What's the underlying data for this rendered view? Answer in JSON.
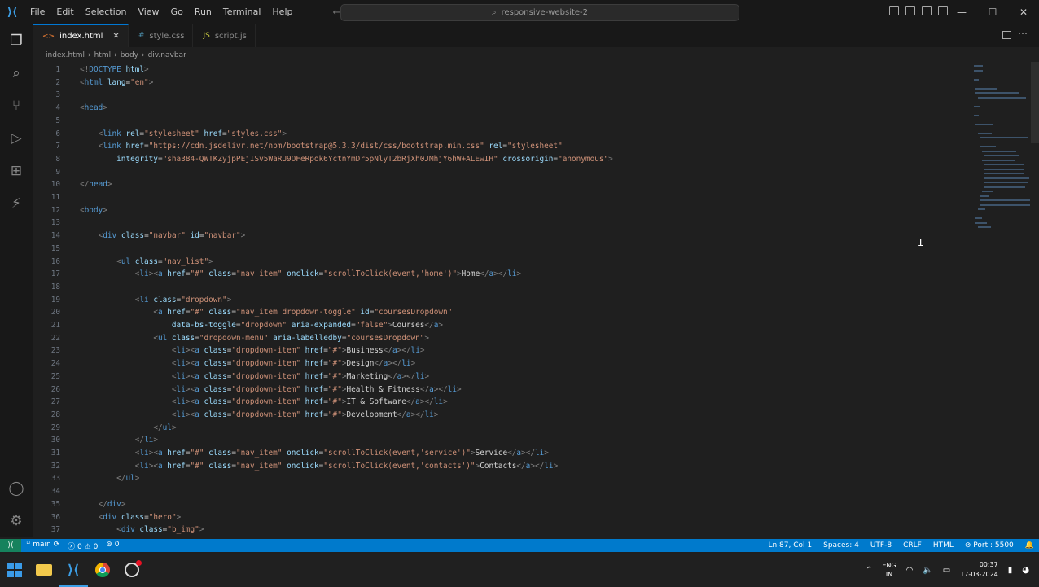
{
  "titlebar": {
    "menu": [
      "File",
      "Edit",
      "Selection",
      "View",
      "Go",
      "Run",
      "Terminal",
      "Help"
    ],
    "search_text": "responsive-website-2"
  },
  "tabs": [
    {
      "label": "index.html",
      "icon": "<>",
      "active": true
    },
    {
      "label": "style.css",
      "icon": "#",
      "active": false
    },
    {
      "label": "script.js",
      "icon": "JS",
      "active": false
    }
  ],
  "breadcrumb": [
    "index.html",
    "html",
    "body",
    "div.navbar"
  ],
  "code_lines": [
    {
      "n": "1",
      "html": "<span class='t'>&lt;!</span><span class='tg'>DOCTYPE</span> <span class='at'>html</span><span class='t'>&gt;</span>"
    },
    {
      "n": "2",
      "html": "<span class='t'>&lt;</span><span class='tg'>html</span> <span class='at'>lang</span><span class='tx'>=</span><span class='st'>\"en\"</span><span class='t'>&gt;</span>"
    },
    {
      "n": "3",
      "html": ""
    },
    {
      "n": "4",
      "html": "<span class='t'>&lt;</span><span class='tg'>head</span><span class='t'>&gt;</span>"
    },
    {
      "n": "5",
      "html": ""
    },
    {
      "n": "6",
      "html": "    <span class='t'>&lt;</span><span class='tg'>link</span> <span class='at'>rel</span><span class='tx'>=</span><span class='st'>\"stylesheet\"</span> <span class='at'>href</span><span class='tx'>=</span><span class='st'>\"styles.css\"</span><span class='t'>&gt;</span>"
    },
    {
      "n": "7",
      "html": "    <span class='t'>&lt;</span><span class='tg'>link</span> <span class='at'>href</span><span class='tx'>=</span><span class='st'>\"https://cdn.jsdelivr.net/npm/bootstrap@5.3.3/dist/css/bootstrap.min.css\"</span> <span class='at'>rel</span><span class='tx'>=</span><span class='st'>\"stylesheet\"</span>"
    },
    {
      "n": "8",
      "html": "        <span class='at'>integrity</span><span class='tx'>=</span><span class='st'>\"sha384-QWTKZyjpPEjISv5WaRU9OFeRpok6YctnYmDr5pNlyT2bRjXh0JMhjY6hW+ALEwIH\"</span> <span class='at'>crossorigin</span><span class='tx'>=</span><span class='st'>\"anonymous\"</span><span class='t'>&gt;</span>"
    },
    {
      "n": "9",
      "html": ""
    },
    {
      "n": "10",
      "html": "<span class='t'>&lt;/</span><span class='tg'>head</span><span class='t'>&gt;</span>"
    },
    {
      "n": "11",
      "html": ""
    },
    {
      "n": "12",
      "html": "<span class='t'>&lt;</span><span class='tg'>body</span><span class='t'>&gt;</span>"
    },
    {
      "n": "13",
      "html": ""
    },
    {
      "n": "14",
      "html": "    <span class='t'>&lt;</span><span class='tg'>div</span> <span class='at'>class</span><span class='tx'>=</span><span class='st'>\"navbar\"</span> <span class='at'>id</span><span class='tx'>=</span><span class='st'>\"navbar\"</span><span class='t'>&gt;</span>"
    },
    {
      "n": "15",
      "html": ""
    },
    {
      "n": "16",
      "html": "        <span class='t'>&lt;</span><span class='tg'>ul</span> <span class='at'>class</span><span class='tx'>=</span><span class='st'>\"nav_list\"</span><span class='t'>&gt;</span>"
    },
    {
      "n": "17",
      "html": "            <span class='t'>&lt;</span><span class='tg'>li</span><span class='t'>&gt;&lt;</span><span class='tg'>a</span> <span class='at'>href</span><span class='tx'>=</span><span class='st'>\"#\"</span> <span class='at'>class</span><span class='tx'>=</span><span class='st'>\"nav_item\"</span> <span class='at'>onclick</span><span class='tx'>=</span><span class='st'>\"scrollToClick(event,'home')\"</span><span class='t'>&gt;</span><span class='tx'>Home</span><span class='t'>&lt;/</span><span class='tg'>a</span><span class='t'>&gt;&lt;/</span><span class='tg'>li</span><span class='t'>&gt;</span>"
    },
    {
      "n": "18",
      "html": ""
    },
    {
      "n": "19",
      "html": "            <span class='t'>&lt;</span><span class='tg'>li</span> <span class='at'>class</span><span class='tx'>=</span><span class='st'>\"dropdown\"</span><span class='t'>&gt;</span>"
    },
    {
      "n": "20",
      "html": "                <span class='t'>&lt;</span><span class='tg'>a</span> <span class='at'>href</span><span class='tx'>=</span><span class='st'>\"#\"</span> <span class='at'>class</span><span class='tx'>=</span><span class='st'>\"nav_item dropdown-toggle\"</span> <span class='at'>id</span><span class='tx'>=</span><span class='st'>\"coursesDropdown\"</span>"
    },
    {
      "n": "21",
      "html": "                    <span class='at'>data-bs-toggle</span><span class='tx'>=</span><span class='st'>\"dropdown\"</span> <span class='at'>aria-expanded</span><span class='tx'>=</span><span class='st'>\"false\"</span><span class='t'>&gt;</span><span class='tx'>Courses</span><span class='t'>&lt;/</span><span class='tg'>a</span><span class='t'>&gt;</span>"
    },
    {
      "n": "22",
      "html": "                <span class='t'>&lt;</span><span class='tg'>ul</span> <span class='at'>class</span><span class='tx'>=</span><span class='st'>\"dropdown-menu\"</span> <span class='at'>aria-labelledby</span><span class='tx'>=</span><span class='st'>\"coursesDropdown\"</span><span class='t'>&gt;</span>"
    },
    {
      "n": "23",
      "html": "                    <span class='t'>&lt;</span><span class='tg'>li</span><span class='t'>&gt;&lt;</span><span class='tg'>a</span> <span class='at'>class</span><span class='tx'>=</span><span class='st'>\"dropdown-item\"</span> <span class='at'>href</span><span class='tx'>=</span><span class='st'>\"#\"</span><span class='t'>&gt;</span><span class='tx'>Business</span><span class='t'>&lt;/</span><span class='tg'>a</span><span class='t'>&gt;&lt;/</span><span class='tg'>li</span><span class='t'>&gt;</span>"
    },
    {
      "n": "24",
      "html": "                    <span class='t'>&lt;</span><span class='tg'>li</span><span class='t'>&gt;&lt;</span><span class='tg'>a</span> <span class='at'>class</span><span class='tx'>=</span><span class='st'>\"dropdown-item\"</span> <span class='at'>href</span><span class='tx'>=</span><span class='st'>\"#\"</span><span class='t'>&gt;</span><span class='tx'>Design</span><span class='t'>&lt;/</span><span class='tg'>a</span><span class='t'>&gt;&lt;/</span><span class='tg'>li</span><span class='t'>&gt;</span>"
    },
    {
      "n": "25",
      "html": "                    <span class='t'>&lt;</span><span class='tg'>li</span><span class='t'>&gt;&lt;</span><span class='tg'>a</span> <span class='at'>class</span><span class='tx'>=</span><span class='st'>\"dropdown-item\"</span> <span class='at'>href</span><span class='tx'>=</span><span class='st'>\"#\"</span><span class='t'>&gt;</span><span class='tx'>Marketing</span><span class='t'>&lt;/</span><span class='tg'>a</span><span class='t'>&gt;&lt;/</span><span class='tg'>li</span><span class='t'>&gt;</span>"
    },
    {
      "n": "26",
      "html": "                    <span class='t'>&lt;</span><span class='tg'>li</span><span class='t'>&gt;&lt;</span><span class='tg'>a</span> <span class='at'>class</span><span class='tx'>=</span><span class='st'>\"dropdown-item\"</span> <span class='at'>href</span><span class='tx'>=</span><span class='st'>\"#\"</span><span class='t'>&gt;</span><span class='tx'>Health &amp; Fitness</span><span class='t'>&lt;/</span><span class='tg'>a</span><span class='t'>&gt;&lt;/</span><span class='tg'>li</span><span class='t'>&gt;</span>"
    },
    {
      "n": "27",
      "html": "                    <span class='t'>&lt;</span><span class='tg'>li</span><span class='t'>&gt;&lt;</span><span class='tg'>a</span> <span class='at'>class</span><span class='tx'>=</span><span class='st'>\"dropdown-item\"</span> <span class='at'>href</span><span class='tx'>=</span><span class='st'>\"#\"</span><span class='t'>&gt;</span><span class='tx'>IT &amp; Software</span><span class='t'>&lt;/</span><span class='tg'>a</span><span class='t'>&gt;&lt;/</span><span class='tg'>li</span><span class='t'>&gt;</span>"
    },
    {
      "n": "28",
      "html": "                    <span class='t'>&lt;</span><span class='tg'>li</span><span class='t'>&gt;&lt;</span><span class='tg'>a</span> <span class='at'>class</span><span class='tx'>=</span><span class='st'>\"dropdown-item\"</span> <span class='at'>href</span><span class='tx'>=</span><span class='st'>\"#\"</span><span class='t'>&gt;</span><span class='tx'>Development</span><span class='t'>&lt;/</span><span class='tg'>a</span><span class='t'>&gt;&lt;/</span><span class='tg'>li</span><span class='t'>&gt;</span>"
    },
    {
      "n": "29",
      "html": "                <span class='t'>&lt;/</span><span class='tg'>ul</span><span class='t'>&gt;</span>"
    },
    {
      "n": "30",
      "html": "            <span class='t'>&lt;/</span><span class='tg'>li</span><span class='t'>&gt;</span>"
    },
    {
      "n": "31",
      "html": "            <span class='t'>&lt;</span><span class='tg'>li</span><span class='t'>&gt;&lt;</span><span class='tg'>a</span> <span class='at'>href</span><span class='tx'>=</span><span class='st'>\"#\"</span> <span class='at'>class</span><span class='tx'>=</span><span class='st'>\"nav_item\"</span> <span class='at'>onclick</span><span class='tx'>=</span><span class='st'>\"scrollToClick(event,'service')\"</span><span class='t'>&gt;</span><span class='tx'>Service</span><span class='t'>&lt;/</span><span class='tg'>a</span><span class='t'>&gt;&lt;/</span><span class='tg'>li</span><span class='t'>&gt;</span>"
    },
    {
      "n": "32",
      "html": "            <span class='t'>&lt;</span><span class='tg'>li</span><span class='t'>&gt;&lt;</span><span class='tg'>a</span> <span class='at'>href</span><span class='tx'>=</span><span class='st'>\"#\"</span> <span class='at'>class</span><span class='tx'>=</span><span class='st'>\"nav_item\"</span> <span class='at'>onclick</span><span class='tx'>=</span><span class='st'>\"scrollToClick(event,'contacts')\"</span><span class='t'>&gt;</span><span class='tx'>Contacts</span><span class='t'>&lt;/</span><span class='tg'>a</span><span class='t'>&gt;&lt;/</span><span class='tg'>li</span><span class='t'>&gt;</span>"
    },
    {
      "n": "33",
      "html": "        <span class='t'>&lt;/</span><span class='tg'>ul</span><span class='t'>&gt;</span>"
    },
    {
      "n": "34",
      "html": ""
    },
    {
      "n": "35",
      "html": "    <span class='t'>&lt;/</span><span class='tg'>div</span><span class='t'>&gt;</span>"
    },
    {
      "n": "36",
      "html": "    <span class='t'>&lt;</span><span class='tg'>div</span> <span class='at'>class</span><span class='tx'>=</span><span class='st'>\"hero\"</span><span class='t'>&gt;</span>"
    },
    {
      "n": "37",
      "html": "        <span class='t'>&lt;</span><span class='tg'>div</span> <span class='at'>class</span><span class='tx'>=</span><span class='st'>\"b_img\"</span><span class='t'>&gt;</span>"
    }
  ],
  "statusbar": {
    "branch": "main",
    "errors": "0",
    "warnings": "0",
    "ports": "0",
    "position": "Ln 87, Col 1",
    "spaces": "Spaces: 4",
    "encoding": "UTF-8",
    "eol": "CRLF",
    "language": "HTML",
    "port": "Port : 5500"
  },
  "taskbar": {
    "lang_top": "ENG",
    "lang_bottom": "IN",
    "time": "00:37",
    "date": "17-03-2024"
  },
  "colors": {
    "accent": "#007acc",
    "tag": "#569cd6",
    "attr": "#9cdcfe",
    "string": "#ce9178"
  }
}
